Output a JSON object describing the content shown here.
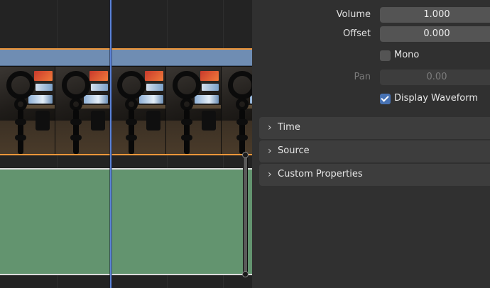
{
  "properties": {
    "volume": {
      "label": "Volume",
      "value": "1.000"
    },
    "offset": {
      "label": "Offset",
      "value": "0.000"
    },
    "mono": {
      "label": "Mono",
      "checked": false
    },
    "pan": {
      "label": "Pan",
      "value": "0.00",
      "enabled": false
    },
    "display_waveform": {
      "label": "Display Waveform",
      "checked": true
    }
  },
  "sections": [
    {
      "label": "Time",
      "icon": "chevron-right-icon",
      "expanded": false
    },
    {
      "label": "Source",
      "icon": "chevron-right-icon",
      "expanded": false
    },
    {
      "label": "Custom Properties",
      "icon": "chevron-right-icon",
      "expanded": false
    }
  ],
  "timeline": {
    "video_strip_color": "#6f8db3",
    "selection_outline_color": "#f0973a",
    "audio_strip_color": "#63946f",
    "playhead_color": "#5b82d6",
    "thumbnail_count": 5
  },
  "colors": {
    "panel_bg": "#303030",
    "field_bg": "#545454",
    "checkbox_checked": "#4772b3"
  }
}
